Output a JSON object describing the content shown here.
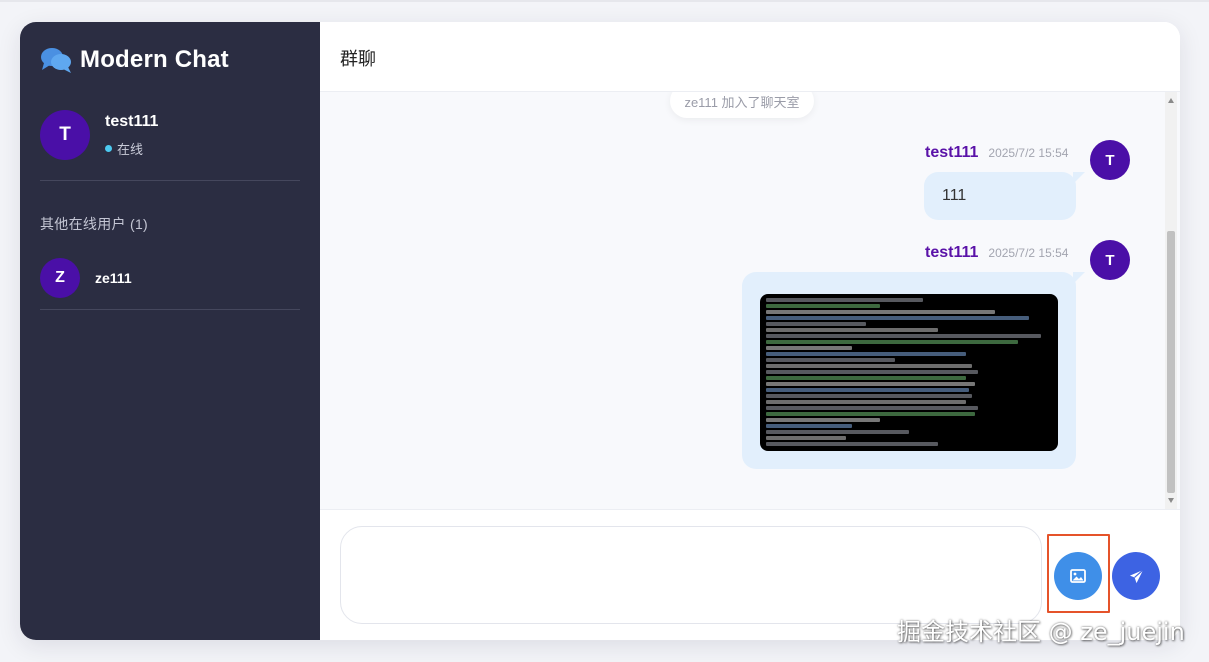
{
  "app": {
    "title": "Modern Chat",
    "icon": "comments-icon",
    "accent_color": "#4a0fa7",
    "sidebar_bg": "#2b2d42"
  },
  "current_user": {
    "initial": "T",
    "name": "test111",
    "status": "在线",
    "status_color": "#4cc9f0"
  },
  "online_users": {
    "label": "其他在线用户 (1)",
    "items": [
      {
        "initial": "Z",
        "name": "ze111"
      }
    ]
  },
  "chat": {
    "room_title": "群聊",
    "system_message": "ze111 加入了聊天室",
    "messages": [
      {
        "sender": "test111",
        "initial": "T",
        "time": "2025/7/2 15:54",
        "type": "text",
        "text": "111"
      },
      {
        "sender": "test111",
        "initial": "T",
        "time": "2025/7/2 15:54",
        "type": "image",
        "image_desc": "terminal-screenshot"
      }
    ]
  },
  "composer": {
    "input_value": "",
    "image_button_icon": "image-icon",
    "send_button_icon": "send-icon"
  },
  "watermark": "掘金技术社区 @ ze_juejin"
}
